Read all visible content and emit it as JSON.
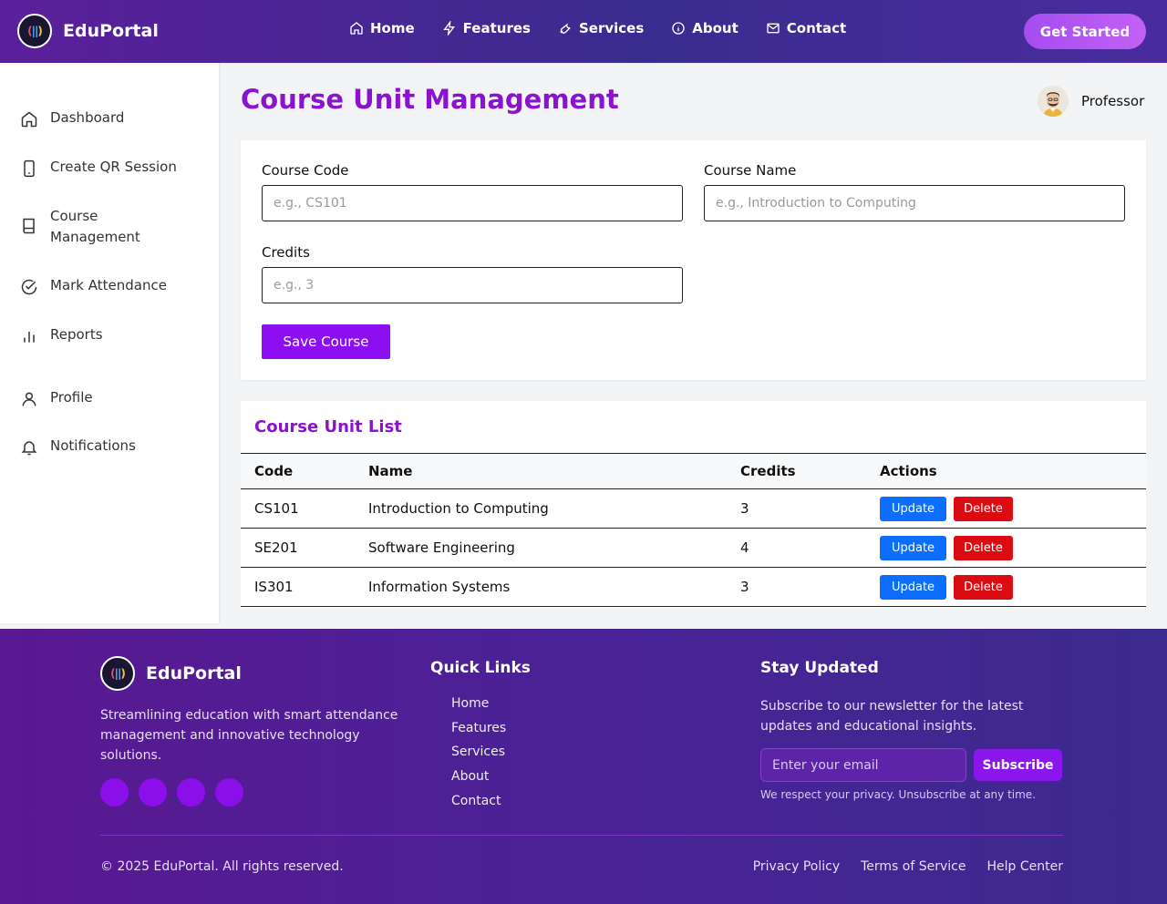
{
  "header": {
    "brand": "EduPortal",
    "nav": [
      {
        "label": "Home",
        "icon": "home-icon"
      },
      {
        "label": "Features",
        "icon": "bolt-icon"
      },
      {
        "label": "Services",
        "icon": "wrench-icon"
      },
      {
        "label": "About",
        "icon": "info-icon"
      },
      {
        "label": "Contact",
        "icon": "mail-icon"
      }
    ],
    "cta_label": "Get Started"
  },
  "sidebar": {
    "items": [
      {
        "label": "Dashboard",
        "icon": "home-icon"
      },
      {
        "label": "Create QR Session",
        "icon": "phone-icon"
      },
      {
        "label": "Course Management",
        "icon": "book-icon"
      },
      {
        "label": "Mark Attendance",
        "icon": "check-circle-icon"
      },
      {
        "label": "Reports",
        "icon": "bar-chart-icon"
      },
      {
        "label": "Profile",
        "icon": "user-icon"
      },
      {
        "label": "Notifications",
        "icon": "bell-icon"
      }
    ]
  },
  "main": {
    "title": "Course Unit Management",
    "user_role": "Professor",
    "form": {
      "course_code_label": "Course Code",
      "course_code_placeholder": "e.g., CS101",
      "course_name_label": "Course Name",
      "course_name_placeholder": "e.g., Introduction to Computing",
      "credits_label": "Credits",
      "credits_placeholder": "e.g., 3",
      "save_label": "Save Course"
    },
    "list": {
      "title": "Course Unit List",
      "columns": [
        "Code",
        "Name",
        "Credits",
        "Actions"
      ],
      "rows": [
        {
          "code": "CS101",
          "name": "Introduction to Computing",
          "credits": "3"
        },
        {
          "code": "SE201",
          "name": "Software Engineering",
          "credits": "4"
        },
        {
          "code": "IS301",
          "name": "Information Systems",
          "credits": "3"
        }
      ],
      "update_label": "Update",
      "delete_label": "Delete"
    }
  },
  "footer": {
    "brand": "EduPortal",
    "description": "Streamlining education with smart attendance management and innovative technology solutions.",
    "quick_links_title": "Quick Links",
    "quick_links": [
      "Home",
      "Features",
      "Services",
      "About",
      "Contact"
    ],
    "newsletter_title": "Stay Updated",
    "newsletter_text": "Subscribe to our newsletter for the latest updates and educational insights.",
    "email_placeholder": "Enter your email",
    "subscribe_label": "Subscribe",
    "privacy_note": "We respect your privacy. Unsubscribe at any time.",
    "copyright": "© 2025 EduPortal. All rights reserved.",
    "legal_links": [
      "Privacy Policy",
      "Terms of Service",
      "Help Center"
    ]
  },
  "colors": {
    "accent": "#8b13cf",
    "primary_button": "#8b0ff0",
    "update_button": "#0d6efd",
    "delete_button": "#dc0b12"
  }
}
